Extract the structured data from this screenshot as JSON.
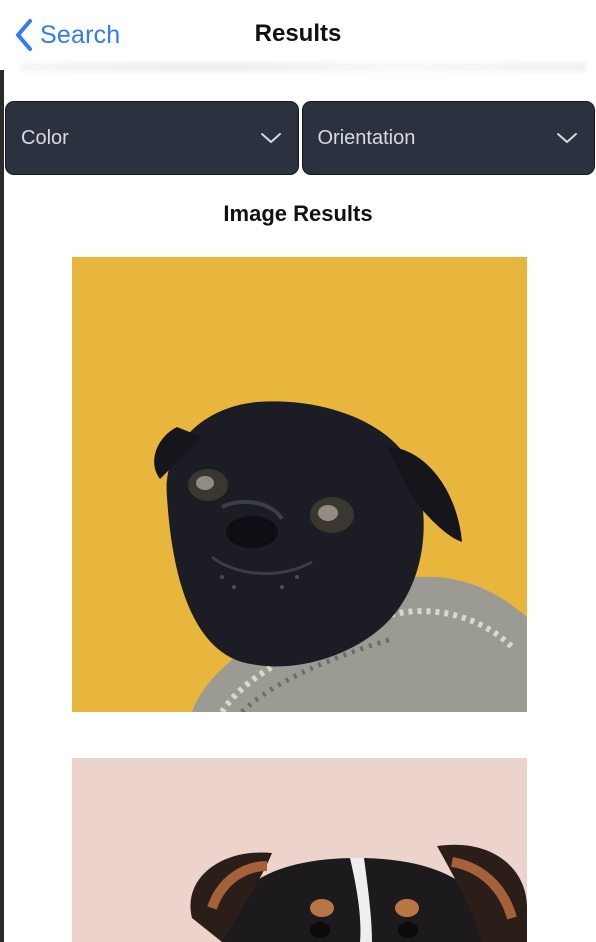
{
  "nav": {
    "back_label": "Search",
    "title": "Results"
  },
  "filters": {
    "color_label": "Color",
    "orientation_label": "Orientation"
  },
  "section": {
    "title": "Image Results"
  },
  "results": [
    {
      "subject": "black pug in knitted sweater on yellow background"
    },
    {
      "subject": "tricolor dog on pink background"
    }
  ],
  "colors": {
    "accent": "#2f7cf6",
    "dropdown_bg": "#2c3140",
    "dropdown_text": "#d8dae0",
    "result1_bg": "#e8b53d",
    "result2_bg": "#ecd4cd"
  },
  "icons": {
    "back": "chevron-left-icon",
    "dropdown": "chevron-down-icon"
  }
}
